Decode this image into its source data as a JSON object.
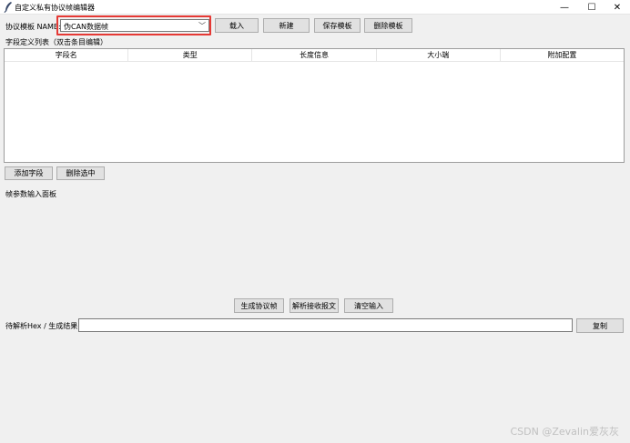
{
  "window": {
    "title": "自定义私有协议帧编辑器",
    "minimize_glyph": "—",
    "maximize_glyph": "☐",
    "close_glyph": "✕",
    "icon": "feather-icon"
  },
  "template_bar": {
    "label": "协议模板 NAME:",
    "selected": "伪CAN数据帧",
    "load_label": "载入",
    "new_label": "新建",
    "save_label": "保存模板",
    "delete_label": "删除模板"
  },
  "fields": {
    "title": "字段定义列表（双击条目编辑）",
    "columns": [
      "字段名",
      "类型",
      "长度信息",
      "大小端",
      "附加配置"
    ],
    "rows": [],
    "add_label": "添加字段",
    "remove_label": "删除选中"
  },
  "params_panel": {
    "title": "帧参数输入面板"
  },
  "actions": {
    "generate_label": "生成协议帧",
    "parse_label": "解析接收报文",
    "clear_label": "清空输入"
  },
  "hex": {
    "label": "待解析Hex / 生成结果:",
    "value": "",
    "copy_label": "复制"
  },
  "watermark": "CSDN @Zevalin爱灰灰",
  "colors": {
    "highlight": "#e53935",
    "background": "#f0f0f0"
  }
}
